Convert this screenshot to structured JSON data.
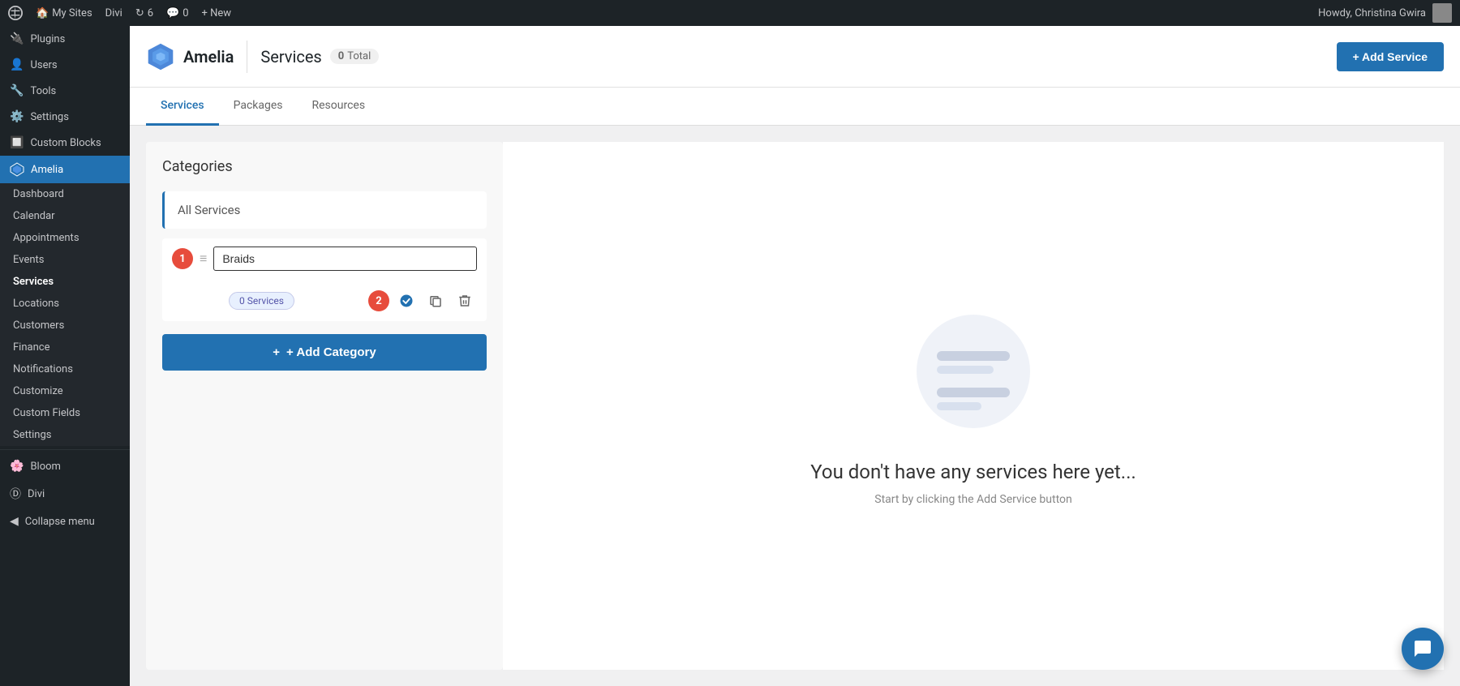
{
  "adminBar": {
    "wpLabel": "W",
    "mySites": "My Sites",
    "divi": "Divi",
    "updates": "6",
    "comments": "0",
    "newLabel": "+ New",
    "greetingLabel": "Howdy, Christina Gwira"
  },
  "sidebar": {
    "plugins": "Plugins",
    "users": "Users",
    "tools": "Tools",
    "settings": "Settings",
    "customBlocks": "Custom Blocks",
    "amelia": "Amelia",
    "subItems": [
      {
        "label": "Dashboard",
        "key": "dashboard"
      },
      {
        "label": "Calendar",
        "key": "calendar"
      },
      {
        "label": "Appointments",
        "key": "appointments"
      },
      {
        "label": "Events",
        "key": "events"
      },
      {
        "label": "Services",
        "key": "services",
        "active": true
      },
      {
        "label": "Locations",
        "key": "locations"
      },
      {
        "label": "Customers",
        "key": "customers"
      },
      {
        "label": "Finance",
        "key": "finance"
      },
      {
        "label": "Notifications",
        "key": "notifications"
      },
      {
        "label": "Customize",
        "key": "customize"
      },
      {
        "label": "Custom Fields",
        "key": "custom-fields"
      },
      {
        "label": "Settings",
        "key": "amelia-settings"
      }
    ],
    "bloom": "Bloom",
    "diviBottom": "Divi",
    "collapseMenu": "Collapse menu"
  },
  "header": {
    "logoText": "Amelia",
    "pageTitle": "Services",
    "totalLabel": "Total",
    "totalCount": "0",
    "addServiceBtn": "+ Add Service"
  },
  "tabs": [
    {
      "label": "Services",
      "active": true,
      "key": "services"
    },
    {
      "label": "Packages",
      "active": false,
      "key": "packages"
    },
    {
      "label": "Resources",
      "active": false,
      "key": "resources"
    }
  ],
  "categories": {
    "title": "Categories",
    "allServices": "All Services",
    "categoryItem": {
      "number": "1",
      "inputValue": "Braids",
      "servicesBadge": "0 Services",
      "actionNumber": "2"
    },
    "addCategoryBtn": "+ Add Category"
  },
  "emptyState": {
    "title": "You don't have any services here yet...",
    "subtitle": "Start by clicking the Add Service button"
  }
}
